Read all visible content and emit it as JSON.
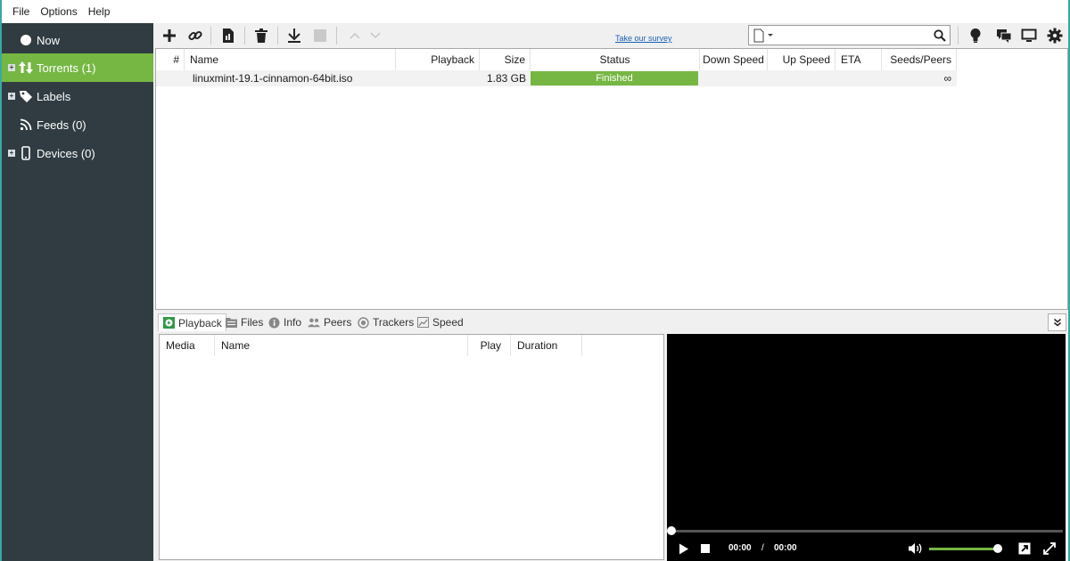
{
  "menu": {
    "file": "File",
    "options": "Options",
    "help": "Help"
  },
  "sidebar": {
    "items": [
      {
        "label": "Now",
        "icon": "circle-icon"
      },
      {
        "label": "Torrents (1)",
        "icon": "transfer-arrows-icon",
        "active": true
      },
      {
        "label": "Labels",
        "icon": "tag-icon"
      },
      {
        "label": "Feeds (0)",
        "icon": "rss-icon"
      },
      {
        "label": "Devices (0)",
        "icon": "phone-icon"
      }
    ],
    "active_color": "#76b744",
    "bg_color": "#303c41"
  },
  "toolbar": {
    "survey_link": "Take our survey",
    "search": {
      "value": "",
      "placeholder": ""
    }
  },
  "torrent_list": {
    "columns": [
      "#",
      "Name",
      "Playback",
      "Size",
      "Status",
      "Down Speed",
      "Up Speed",
      "ETA",
      "Seeds/Peers"
    ],
    "rows": [
      {
        "num": "",
        "name": "linuxmint-19.1-cinnamon-64bit.iso",
        "playback": "",
        "size": "1.83 GB",
        "status": "Finished",
        "down_speed": "",
        "up_speed": "",
        "eta": "",
        "seeds_peers": "∞"
      }
    ]
  },
  "details": {
    "tabs": [
      {
        "label": "Playback",
        "icon": "playback-icon",
        "active": true
      },
      {
        "label": "Files",
        "icon": "files-icon"
      },
      {
        "label": "Info",
        "icon": "info-icon"
      },
      {
        "label": "Peers",
        "icon": "peers-icon"
      },
      {
        "label": "Trackers",
        "icon": "trackers-icon"
      },
      {
        "label": "Speed",
        "icon": "speed-icon"
      }
    ],
    "media_columns": [
      "Media",
      "Name",
      "Play",
      "Duration"
    ],
    "player": {
      "current_time": "00:00",
      "separator": "/",
      "total_time": "00:00",
      "volume_level": 0.95
    }
  }
}
